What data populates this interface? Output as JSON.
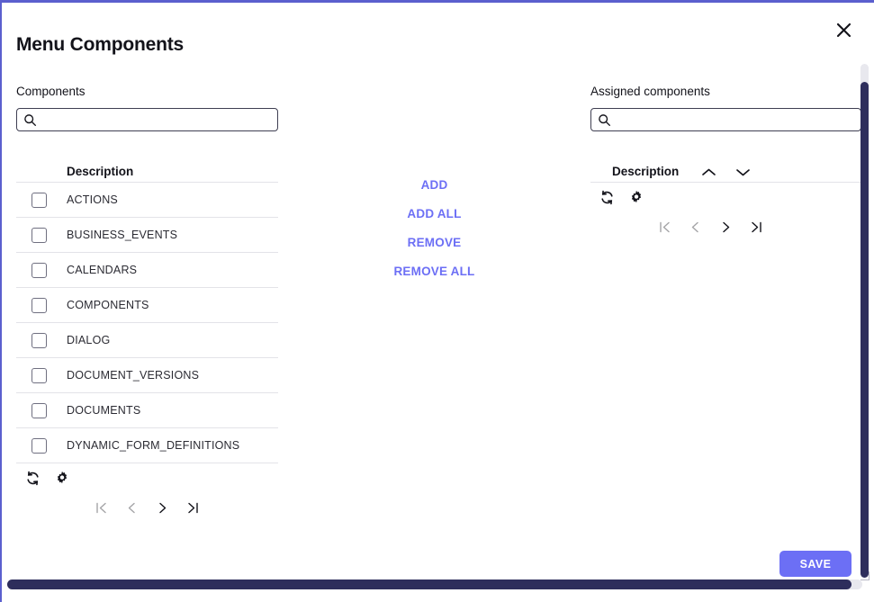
{
  "dialog": {
    "title": "Menu Components",
    "close_label": "close-icon"
  },
  "left_panel": {
    "label": "Components",
    "search": {
      "value": "",
      "placeholder": ""
    },
    "column_header": "Description",
    "rows": [
      {
        "label": "ACTIONS",
        "checked": false
      },
      {
        "label": "BUSINESS_EVENTS",
        "checked": false
      },
      {
        "label": "CALENDARS",
        "checked": false
      },
      {
        "label": "COMPONENTS",
        "checked": false
      },
      {
        "label": "DIALOG",
        "checked": false
      },
      {
        "label": "DOCUMENT_VERSIONS",
        "checked": false
      },
      {
        "label": "DOCUMENTS",
        "checked": false
      },
      {
        "label": "DYNAMIC_FORM_DEFINITIONS",
        "checked": false
      }
    ],
    "tools": {
      "refresh": "refresh-icon",
      "settings": "gear-icon"
    },
    "pagination": {
      "first": "first-page-icon",
      "prev": "previous-page-icon",
      "next": "next-page-icon",
      "last": "last-page-icon"
    }
  },
  "center_actions": [
    {
      "label": "ADD"
    },
    {
      "label": "ADD ALL"
    },
    {
      "label": "REMOVE"
    },
    {
      "label": "REMOVE ALL"
    }
  ],
  "right_panel": {
    "label": "Assigned components",
    "search": {
      "value": "",
      "placeholder": ""
    },
    "column_header": "Description",
    "sort": {
      "asc": "sort-ascending-icon",
      "desc": "sort-descending-icon"
    },
    "rows": [],
    "tools": {
      "refresh": "refresh-icon",
      "settings": "gear-icon"
    },
    "pagination": {
      "first": "first-page-icon",
      "prev": "previous-page-icon",
      "next": "next-page-icon",
      "last": "last-page-icon"
    }
  },
  "footer": {
    "save_label": "SAVE"
  },
  "colors": {
    "accent": "#6c6ff5",
    "border_accent": "#5b5fce",
    "scrollbar": "#2e2e5c",
    "text": "#13131a",
    "row_divider": "#e3e3e8"
  }
}
